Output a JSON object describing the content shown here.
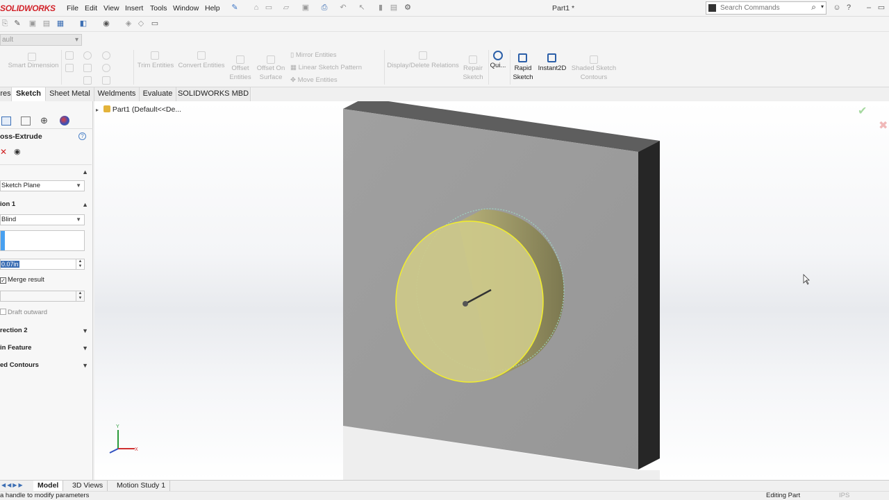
{
  "app": {
    "logo_bold": "SOLIDWORKS",
    "doc_title": "Part1 *"
  },
  "menu": {
    "items": [
      "File",
      "Edit",
      "View",
      "Insert",
      "Tools",
      "Window",
      "Help"
    ]
  },
  "search": {
    "placeholder": "Search Commands"
  },
  "config": {
    "value": "ault"
  },
  "command_manager": {
    "smart_dimension": "Smart Dimension",
    "trim_entities": "Trim Entities",
    "convert_entities": "Convert Entities",
    "offset_entities": "Offset Entities",
    "offset_on_surface": "Offset On Surface",
    "mirror_entities": "Mirror Entities",
    "linear_sketch_pattern": "Linear Sketch Pattern",
    "move_entities": "Move Entities",
    "display_delete_relations": "Display/Delete Relations",
    "repair_sketch": "Repair Sketch",
    "quick_snaps": "Qui...",
    "rapid_sketch": "Rapid Sketch",
    "instant2d": "Instant2D",
    "shaded_sketch_contours": "Shaded Sketch Contours"
  },
  "tabs": [
    "res",
    "Sketch",
    "Sheet Metal",
    "Weldments",
    "Evaluate",
    "SOLIDWORKS MBD"
  ],
  "active_tab": "Sketch",
  "property_manager": {
    "title": "oss-Extrude",
    "from_value": "Sketch Plane",
    "direction1_label": "ion 1",
    "end_condition": "Blind",
    "depth": "0.07in",
    "merge_result": "Merge result",
    "draft_outward": "Draft outward",
    "direction2_label": "rection 2",
    "thin_feature_label": "in Feature",
    "selected_contours_label": "ed Contours"
  },
  "feature_tree": {
    "root": "Part1  (Default<<De..."
  },
  "triad": {
    "x": "X",
    "y": "Y"
  },
  "bottom_tabs": [
    "Model",
    "3D Views",
    "Motion Study 1"
  ],
  "status": {
    "left": "a handle to modify parameters",
    "right": "Editing Part",
    "units": "IPS"
  },
  "colors": {
    "accent_red": "#d2232a",
    "selection_yellow": "#f0ef78",
    "part_gray": "#9d9d9d"
  }
}
